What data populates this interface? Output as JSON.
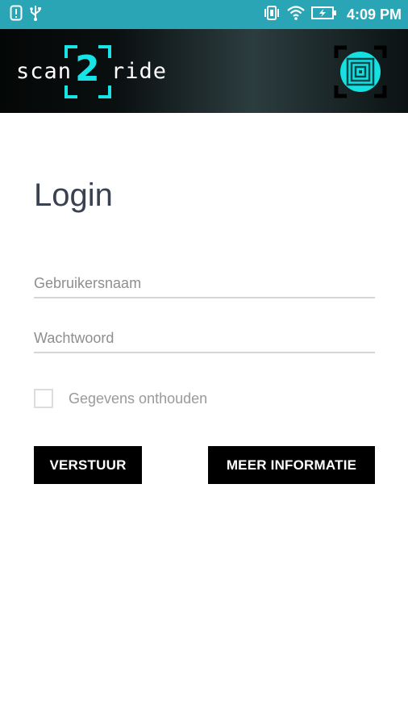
{
  "status_bar": {
    "time": "4:09 PM",
    "left_icons": [
      "alert-notification-icon",
      "usb-icon"
    ],
    "right_icons": [
      "vibrate-icon",
      "wifi-icon",
      "battery-charging-icon"
    ],
    "background": "#2aa5b5"
  },
  "header": {
    "logo": {
      "left": "scan",
      "mid": "2",
      "right": "ride",
      "accent": "#17e4e6"
    },
    "scan_icon": "qr-scan-icon"
  },
  "login": {
    "title": "Login",
    "username_placeholder": "Gebruikersnaam",
    "username_value": "",
    "password_placeholder": "Wachtwoord",
    "password_value": "",
    "remember_label": "Gegevens onthouden",
    "remember_checked": false,
    "submit_label": "VERSTUUR",
    "info_label": "MEER INFORMATIE"
  }
}
